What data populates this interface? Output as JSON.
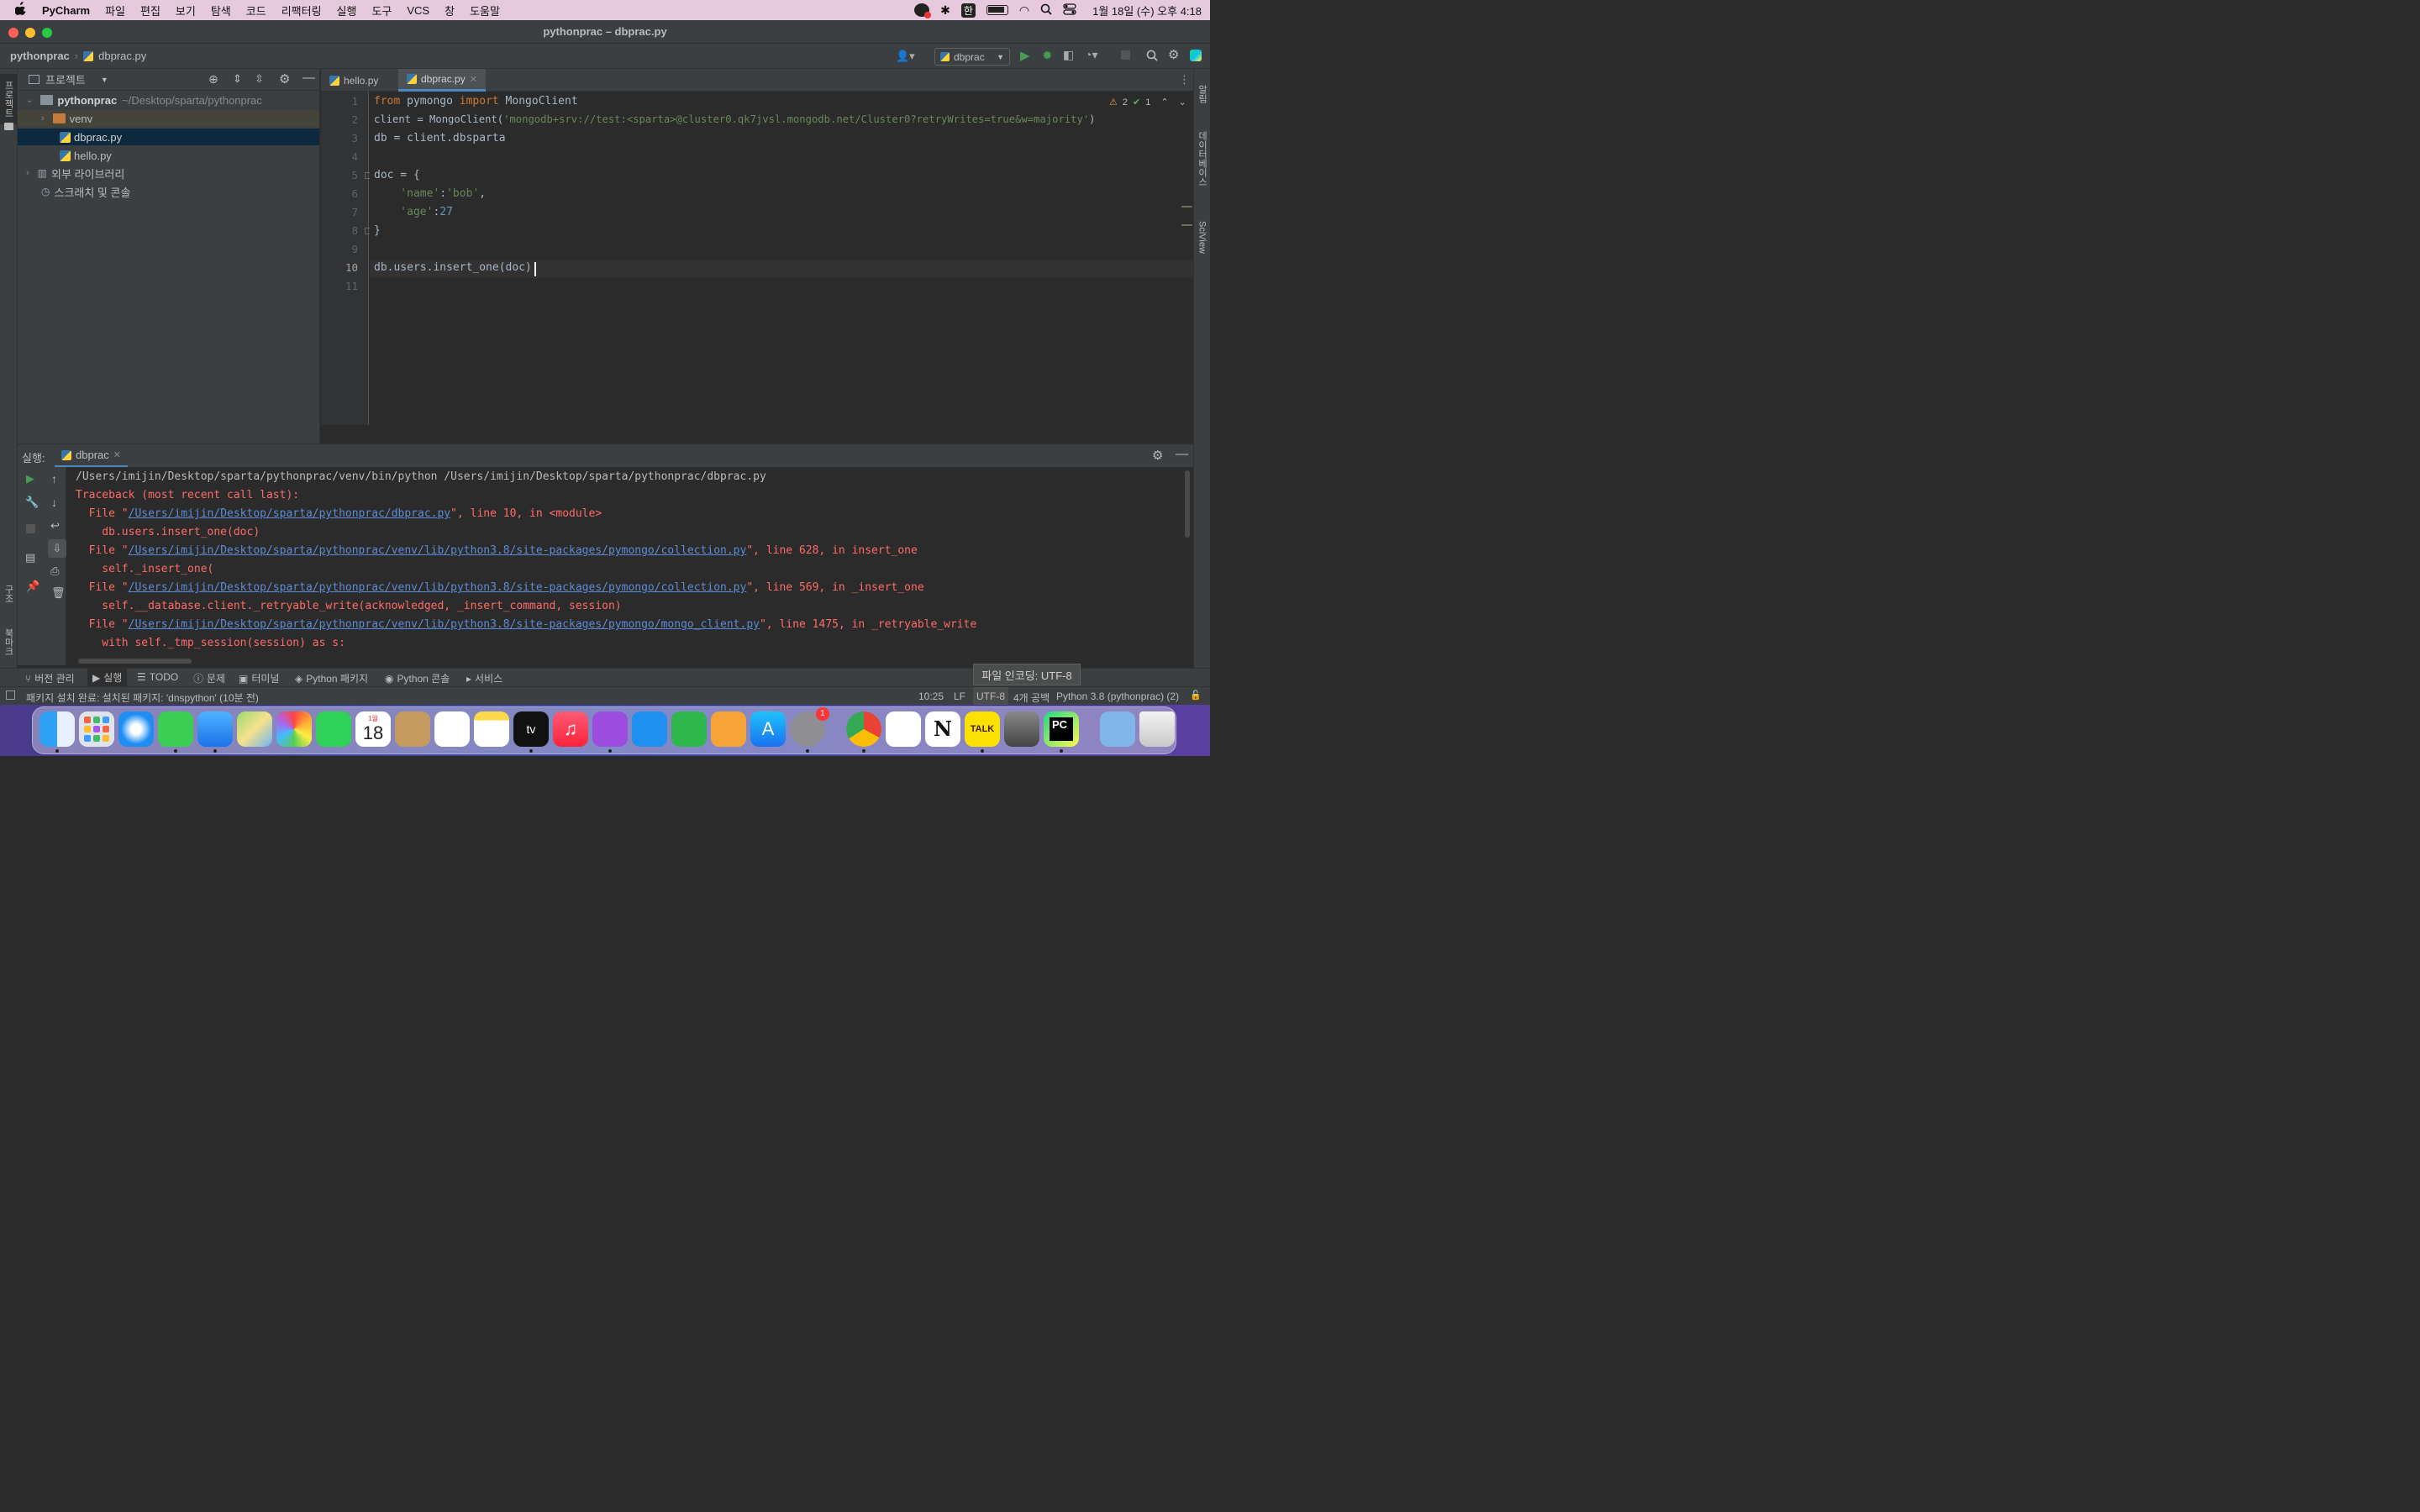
{
  "menubar": {
    "apple": "",
    "app_name": "PyCharm",
    "items": [
      "파일",
      "편집",
      "보기",
      "탐색",
      "코드",
      "리팩터링",
      "실행",
      "도구",
      "VCS",
      "창",
      "도움말"
    ],
    "ime": "한",
    "datetime": "1월 18일 (수) 오후 4:18"
  },
  "window": {
    "title": "pythonprac – dbprac.py"
  },
  "breadcrumb": {
    "project": "pythonprac",
    "file": "dbprac.py"
  },
  "run_config": {
    "name": "dbprac"
  },
  "project_panel": {
    "title": "프로젝트",
    "root_name": "pythonprac",
    "root_path": "~/Desktop/sparta/pythonprac",
    "items": [
      "venv",
      "dbprac.py",
      "hello.py",
      "외부 라이브러리",
      "스크래치 및 콘솔"
    ]
  },
  "left_strip": {
    "project": "프로젝트",
    "structure": "구조",
    "bookmarks": "북마크"
  },
  "right_strip": {
    "notifications": "알림",
    "database": "데이터베이스",
    "sciview": "SciView"
  },
  "editor": {
    "tabs": [
      {
        "label": "hello.py"
      },
      {
        "label": "dbprac.py"
      }
    ],
    "inspections": {
      "warnings": "2",
      "ok": "1"
    },
    "line_numbers": [
      "1",
      "2",
      "3",
      "4",
      "5",
      "6",
      "7",
      "8",
      "9",
      "10",
      "11"
    ],
    "code": {
      "l1_from": "from",
      "l1_mod": " pymongo ",
      "l1_import": "import",
      "l1_rest": " MongoClient",
      "l2_pre": "client = MongoClient(",
      "l2_str": "'mongodb+srv://test:<sparta>@cluster0.qk7jvsl.mongodb.net/Cluster0?retryWrites=true&w=majority'",
      "l2_post": ")",
      "l3": "db = client.dbsparta",
      "l5": "doc = {",
      "l6_key": "    'name'",
      "l6_sep": ":",
      "l6_val": "'bob'",
      "l6_end": ",",
      "l7_key": "    'age'",
      "l7_sep": ":",
      "l7_val": "27",
      "l8": "}",
      "l10": "db.users.insert_one(doc)"
    }
  },
  "run_panel": {
    "label": "실행:",
    "tab": "dbprac",
    "lines": [
      {
        "text": "/Users/imijin/Desktop/sparta/pythonprac/venv/bin/python /Users/imijin/Desktop/sparta/pythonprac/dbprac.py"
      },
      {
        "text": "Traceback (most recent call last):"
      },
      {
        "pre": "  File \"",
        "link": "/Users/imijin/Desktop/sparta/pythonprac/dbprac.py",
        "post": "\", line 10, in <module>"
      },
      {
        "text": "    db.users.insert_one(doc)"
      },
      {
        "pre": "  File \"",
        "link": "/Users/imijin/Desktop/sparta/pythonprac/venv/lib/python3.8/site-packages/pymongo/collection.py",
        "post": "\", line 628, in insert_one"
      },
      {
        "text": "    self._insert_one("
      },
      {
        "pre": "  File \"",
        "link": "/Users/imijin/Desktop/sparta/pythonprac/venv/lib/python3.8/site-packages/pymongo/collection.py",
        "post": "\", line 569, in _insert_one"
      },
      {
        "text": "    self.__database.client._retryable_write(acknowledged, _insert_command, session)"
      },
      {
        "pre": "  File \"",
        "link": "/Users/imijin/Desktop/sparta/pythonprac/venv/lib/python3.8/site-packages/pymongo/mongo_client.py",
        "post": "\", line 1475, in _retryable_write"
      },
      {
        "text": "    with self._tmp_session(session) as s:"
      }
    ]
  },
  "tool_tabs": [
    "버전 관리",
    "실행",
    "TODO",
    "문제",
    "터미널",
    "Python 패키지",
    "Python 콘솔",
    "서비스"
  ],
  "tooltip": "파일 인코딩: UTF-8",
  "status": {
    "message": "패키지 설치 완료: 설치된 패키지: 'dnspython' (10분 전)",
    "position": "10:25",
    "line_sep": "LF",
    "encoding": "UTF-8",
    "indent": "4개 공백",
    "interpreter": "Python 3.8 (pythonprac) (2)"
  },
  "dock": {
    "calendar_month": "1월",
    "calendar_day": "18",
    "tv_label": "tv",
    "kakao": "TALK",
    "notion": "N",
    "pycharm": "PC",
    "settings_badge": "1"
  },
  "colors": {
    "keyword": "#cc7832",
    "string": "#6a8759",
    "number": "#6897bb",
    "error": "#ff6b68",
    "link": "#5c8cd6",
    "menubar": "#e6c9dc"
  }
}
